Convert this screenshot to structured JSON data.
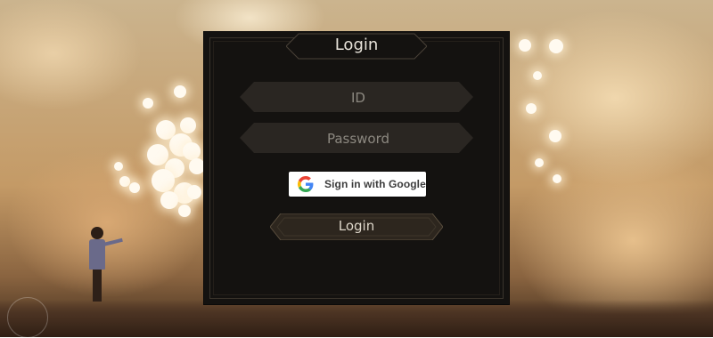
{
  "panel": {
    "title": "Login"
  },
  "form": {
    "id_placeholder": "ID",
    "password_placeholder": "Password",
    "google_label": "Sign in with Google",
    "login_label": "Login"
  },
  "colors": {
    "panel_bg": "#141210",
    "field_bg": "#2a2622",
    "button_bg": "#2d261e",
    "text_light": "#e8e3da",
    "placeholder": "#8c8880"
  },
  "icons": {
    "google": "google-g-icon"
  }
}
